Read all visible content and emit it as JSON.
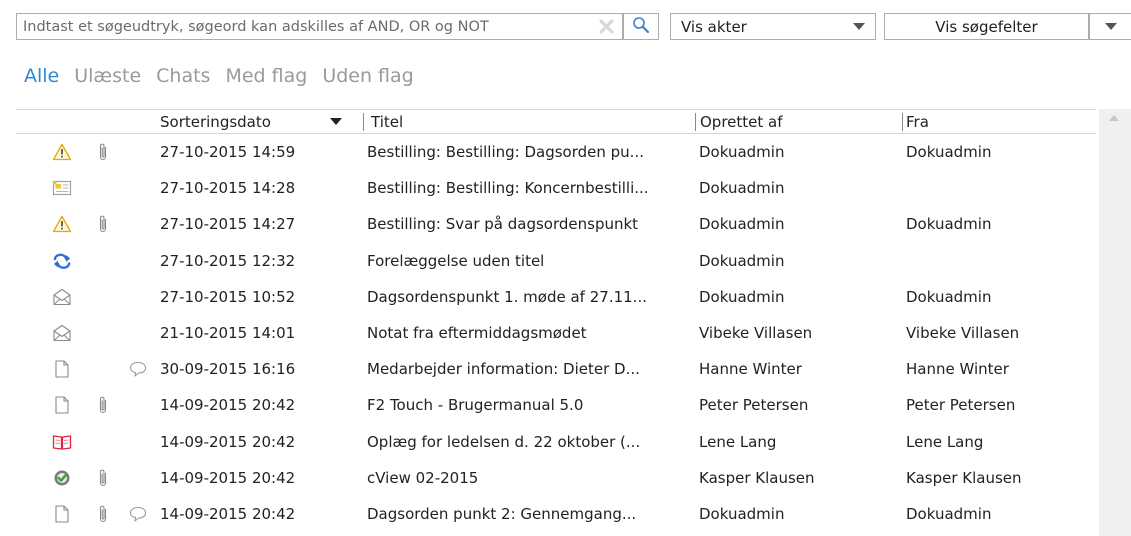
{
  "search": {
    "placeholder": "Indtast et søgeudtryk, søgeord kan adskilles af AND, OR og NOT"
  },
  "filters": {
    "akter_label": "Vis akter",
    "felter_label": "Vis søgefelter"
  },
  "tabs": [
    {
      "label": "Alle",
      "active": true
    },
    {
      "label": "Ulæste",
      "active": false
    },
    {
      "label": "Chats",
      "active": false
    },
    {
      "label": "Med flag",
      "active": false
    },
    {
      "label": "Uden flag",
      "active": false
    }
  ],
  "columns": {
    "date": "Sorteringsdato",
    "title": "Titel",
    "created_by": "Oprettet af",
    "from": "Fra"
  },
  "rows": [
    {
      "icon": "warning-icon",
      "attachment": true,
      "comment": false,
      "date": "27-10-2015 14:59",
      "title": "Bestilling: Bestilling: Dagsorden pu...",
      "created_by": "Dokuadmin",
      "from": "Dokuadmin"
    },
    {
      "icon": "order-card-icon",
      "attachment": false,
      "comment": false,
      "date": "27-10-2015 14:28",
      "title": "Bestilling: Bestilling: Koncernbestilli...",
      "created_by": "Dokuadmin",
      "from": ""
    },
    {
      "icon": "warning-icon",
      "attachment": true,
      "comment": false,
      "date": "27-10-2015 14:27",
      "title": "Bestilling: Svar på dagsordenspunkt",
      "created_by": "Dokuadmin",
      "from": "Dokuadmin"
    },
    {
      "icon": "submission-icon",
      "attachment": false,
      "comment": false,
      "date": "27-10-2015 12:32",
      "title": "Forelæggelse uden titel",
      "created_by": "Dokuadmin",
      "from": ""
    },
    {
      "icon": "envelope-icon",
      "attachment": false,
      "comment": false,
      "date": "27-10-2015 10:52",
      "title": "Dagsordenspunkt 1. møde af 27.11...",
      "created_by": "Dokuadmin",
      "from": "Dokuadmin"
    },
    {
      "icon": "envelope-icon",
      "attachment": false,
      "comment": false,
      "date": "21-10-2015 14:01",
      "title": "Notat fra eftermiddagsmødet",
      "created_by": "Vibeke Villasen",
      "from": "Vibeke Villasen"
    },
    {
      "icon": "document-icon",
      "attachment": false,
      "comment": true,
      "date": "30-09-2015 16:16",
      "title": "Medarbejder information: Dieter D...",
      "created_by": "Hanne Winter",
      "from": "Hanne Winter"
    },
    {
      "icon": "document-icon",
      "attachment": true,
      "comment": false,
      "date": "14-09-2015 20:42",
      "title": "F2 Touch - Brugermanual 5.0",
      "created_by": "Peter Petersen",
      "from": "Peter Petersen"
    },
    {
      "icon": "book-icon",
      "attachment": false,
      "comment": false,
      "date": "14-09-2015 20:42",
      "title": "Oplæg for ledelsen d. 22 oktober (...",
      "created_by": "Lene Lang",
      "from": "Lene Lang"
    },
    {
      "icon": "approved-icon",
      "attachment": true,
      "comment": false,
      "date": "14-09-2015 20:42",
      "title": "cView 02-2015",
      "created_by": "Kasper Klausen",
      "from": "Kasper Klausen"
    },
    {
      "icon": "document-icon",
      "attachment": true,
      "comment": true,
      "date": "14-09-2015 20:42",
      "title": "Dagsorden punkt 2: Gennemgang...",
      "created_by": "Dokuadmin",
      "from": "Dokuadmin"
    }
  ],
  "colors": {
    "accent": "#2e8ad8",
    "tab_inactive": "#9a9a9a",
    "warning": "#f0b400",
    "submission": "#2b6fd6",
    "book": "#d9263e",
    "approved": "#3aa845"
  }
}
